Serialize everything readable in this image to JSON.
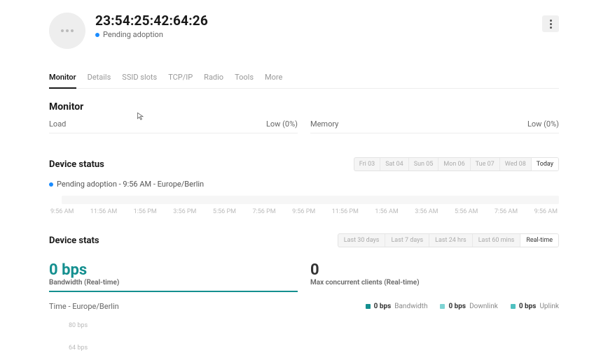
{
  "device": {
    "title": "23:54:25:42:64:26",
    "status": "Pending adoption"
  },
  "tabs": [
    "Monitor",
    "Details",
    "SSID slots",
    "TCP/IP",
    "Radio",
    "Tools",
    "More"
  ],
  "section_title": "Monitor",
  "load": {
    "label": "Load",
    "value": "Low (0%)"
  },
  "memory": {
    "label": "Memory",
    "value": "Low (0%)"
  },
  "device_status": {
    "title": "Device status",
    "days": [
      "Fri 03",
      "Sat 04",
      "Sun 05",
      "Mon 06",
      "Tue 07",
      "Wed 08",
      "Today"
    ],
    "status_line": "Pending adoption - 9:56 AM - Europe/Berlin",
    "time_labels": [
      "9:56 AM",
      "11:56 AM",
      "1:56 PM",
      "3:56 PM",
      "5:56 PM",
      "7:56 PM",
      "9:56 PM",
      "11:56 PM",
      "1:56 AM",
      "3:56 AM",
      "5:56 AM",
      "7:56 AM",
      "9:56 AM"
    ]
  },
  "device_stats": {
    "title": "Device stats",
    "ranges": [
      "Last 30 days",
      "Last 7 days",
      "Last 24 hrs",
      "Last 60 mins",
      "Real-time"
    ],
    "bandwidth_value": "0 bps",
    "bandwidth_label": "Bandwidth (Real-time)",
    "clients_value": "0",
    "clients_label": "Max concurrent clients (Real-time)",
    "time_tz": "Time - Europe/Berlin",
    "legend": {
      "bw_val": "0 bps",
      "bw_txt": "Bandwidth",
      "dl_val": "0 bps",
      "dl_txt": "Downlink",
      "ul_val": "0 bps",
      "ul_txt": "Uplink"
    },
    "ylabels": [
      "80 bps",
      "64 bps"
    ]
  }
}
